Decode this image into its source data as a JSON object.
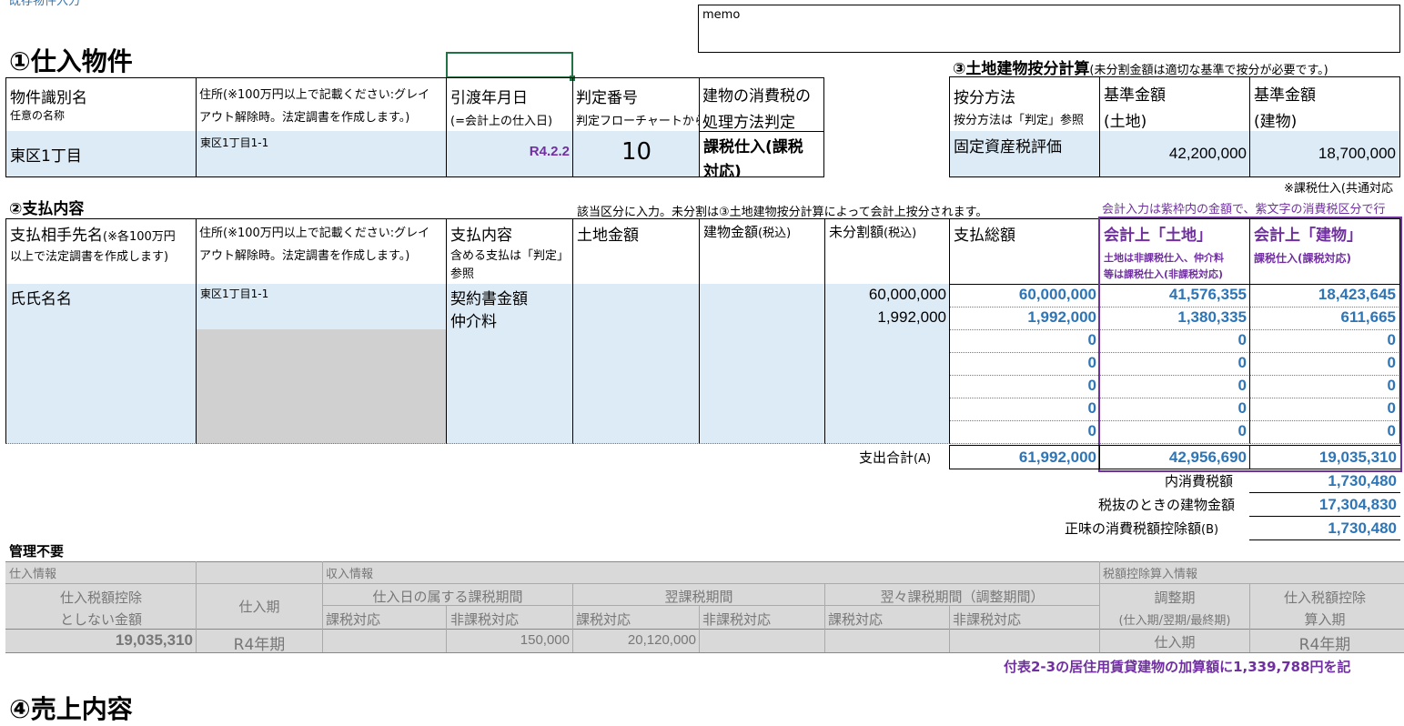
{
  "memo_label": "memo",
  "section1": {
    "title": "①仕入物件",
    "headers": {
      "name": "物件識別名",
      "name_sub": "任意の名称",
      "address": "住所(※100万円以上で記載ください:グレイ",
      "address_sub": "アウト解除時。法定調書を作成します。)",
      "date": "引渡年月日",
      "date_sub": "(=会計上の仕入日)",
      "judge": "判定番号",
      "judge_sub": "判定フローチャートから",
      "tax": "建物の消費税の",
      "tax_sub": "処理方法判定"
    },
    "row": {
      "name": "東区1丁目",
      "address": "東区1丁目1-1",
      "date": "R4.2.2",
      "judge": "10",
      "tax1": "課税仕入(課税",
      "tax2": "対応)"
    }
  },
  "section3": {
    "title": "③土地建物按分計算",
    "note": "(未分割金額は適切な基準で按分が必要です。)",
    "headers": {
      "method": "按分方法",
      "method_sub": "按分方法は「判定」参照",
      "land": "基準金額",
      "land_sub": "(土地)",
      "bldg": "基準金額",
      "bldg_sub": "(建物)"
    },
    "row": {
      "method": "固定資産税評価",
      "land": "42,200,000",
      "bldg": "18,700,000"
    },
    "footnote": "※課税仕入(共通対応"
  },
  "section2": {
    "title": "②支払内容",
    "note": "該当区分に入力。未分割は③土地建物按分計算によって会計上按分されます。",
    "purple_note": "会計入力は紫枠内の金額で、紫文字の消費税区分で行",
    "headers": {
      "payee": "支払相手先名",
      "payee_note1": "(※各100万円",
      "payee_note2": "以上で法定調書を作成します)",
      "address": "住所(※100万円以上で記載ください:グレイ",
      "address_sub": "アウト解除時。法定調書を作成します。)",
      "content": "支払内容",
      "content_sub1": "含める支払は「判定」",
      "content_sub2": "参照",
      "land": "土地金額",
      "bldg": "建物金額",
      "bldg_tax": "(税込)",
      "undiv": "未分割額",
      "undiv_tax": "(税込)",
      "total": "支払総額",
      "acc_land": "会計上「土地」",
      "acc_land_sub1": "土地は非課税仕入、仲介料",
      "acc_land_sub2": "等は課税仕入(非課税対応)",
      "acc_bldg": "会計上「建物」",
      "acc_bldg_sub": "課税仕入(課税対応)"
    },
    "rows": [
      {
        "payee": "氏氏名名",
        "address": "東区1丁目1-1",
        "content": "契約書金額",
        "land": "",
        "bldg": "",
        "undiv": "60,000,000",
        "total": "60,000,000",
        "acc_land": "41,576,355",
        "acc_bldg": "18,423,645"
      },
      {
        "payee": "",
        "address": "",
        "content": "仲介料",
        "land": "",
        "bldg": "",
        "undiv": "1,992,000",
        "total": "1,992,000",
        "acc_land": "1,380,335",
        "acc_bldg": "611,665"
      },
      {
        "payee": "",
        "address": "",
        "content": "",
        "land": "",
        "bldg": "",
        "undiv": "",
        "total": "0",
        "acc_land": "0",
        "acc_bldg": "0"
      },
      {
        "payee": "",
        "address": "",
        "content": "",
        "land": "",
        "bldg": "",
        "undiv": "",
        "total": "0",
        "acc_land": "0",
        "acc_bldg": "0"
      },
      {
        "payee": "",
        "address": "",
        "content": "",
        "land": "",
        "bldg": "",
        "undiv": "",
        "total": "0",
        "acc_land": "0",
        "acc_bldg": "0"
      },
      {
        "payee": "",
        "address": "",
        "content": "",
        "land": "",
        "bldg": "",
        "undiv": "",
        "total": "0",
        "acc_land": "0",
        "acc_bldg": "0"
      },
      {
        "payee": "",
        "address": "",
        "content": "",
        "land": "",
        "bldg": "",
        "undiv": "",
        "total": "0",
        "acc_land": "0",
        "acc_bldg": "0"
      }
    ],
    "sum": {
      "label": "支出合計",
      "label_suffix": "(A)",
      "total": "61,992,000",
      "land": "42,956,690",
      "bldg": "19,035,310"
    },
    "tax_in": {
      "label": "内消費税額",
      "value": "1,730,480"
    },
    "bldg_ex": {
      "label": "税抜のときの建物金額",
      "value": "17,304,830"
    },
    "net_tax": {
      "label": "正味の消費税額控除額",
      "label_suffix": "(B)",
      "value": "1,730,480"
    }
  },
  "management": {
    "title": "管理不要",
    "hdr_purchase": "仕入情報",
    "hdr_income": "収入情報",
    "hdr_credit": "税額控除算入情報",
    "col_notdeduct1": "仕入税額控除",
    "col_notdeduct2": "としない金額",
    "col_period": "仕入期",
    "col_cur": "仕入日の属する課税期間",
    "col_next": "翌課税期間",
    "col_next2": "翌々課税期間（調整期間）",
    "col_adj1": "調整期",
    "col_adj2": "(仕入期/翌期/最終期)",
    "col_credit1": "仕入税額控除",
    "col_credit2": "算入期",
    "sub_taxable": "課税対応",
    "sub_nontax": "非課税対応",
    "row": {
      "notdeduct": "19,035,310",
      "period": "R4年期",
      "cur_taxable": "",
      "cur_nontax": "150,000",
      "next_taxable": "20,120,000",
      "next_nontax": "",
      "next2_taxable": "",
      "next2_nontax": "",
      "adj": "仕入期",
      "credit": "R4年期"
    }
  },
  "footer_note": "付表2-3の居住用賃貸建物の加算額に1,339,788円を記",
  "cut_top_text": "既存物件入力",
  "cut_bottom_title": "④売上内容"
}
